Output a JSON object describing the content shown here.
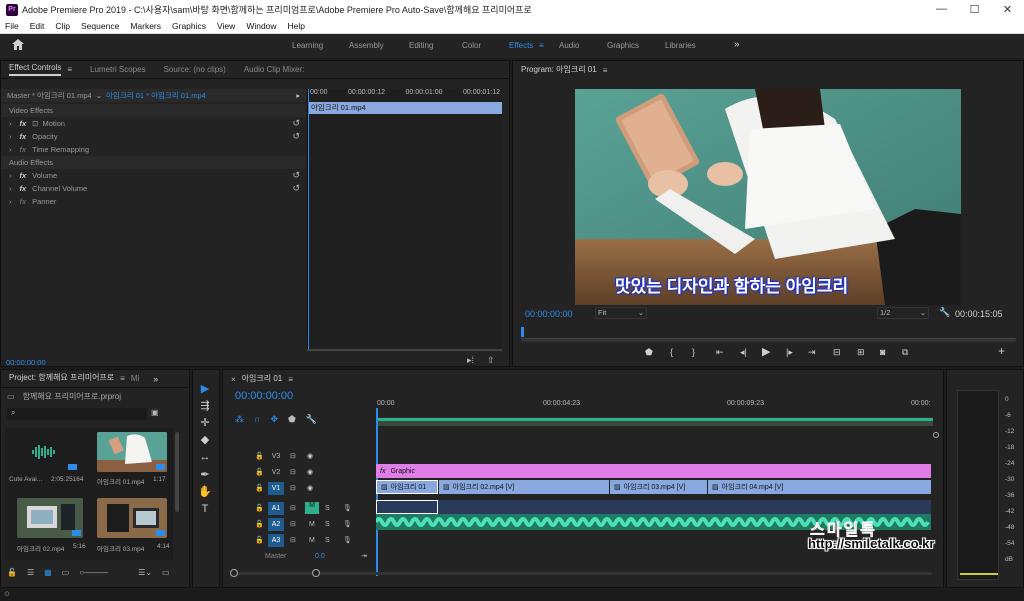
{
  "title_bar": {
    "app_icon": "Pr",
    "title": "Adobe Premiere Pro 2019 - C:\\사용자\\sam\\바탕 화면\\함께하는 프리미엄프로\\Adobe Premiere Pro Auto-Save\\함께해요 프리미어프로",
    "minimize": "—",
    "maximize": "☐",
    "close": "✕"
  },
  "menu": [
    "File",
    "Edit",
    "Clip",
    "Sequence",
    "Markers",
    "Graphics",
    "View",
    "Window",
    "Help"
  ],
  "workspaces": [
    "Learning",
    "Assembly",
    "Editing",
    "Color",
    "Effects",
    "Audio",
    "Graphics",
    "Libraries"
  ],
  "workspace_active": "Effects",
  "workspace_more": "»",
  "source_panel": {
    "tabs": [
      "Effect Controls",
      "Lumetri Scopes",
      "Source: (no clips)",
      "Audio Clip Mixer:"
    ],
    "master_label": "Master * 아임크리 01.mp4",
    "sequence_label": "아임크리 01 * 아임크리 01.mp4",
    "ruler": [
      "00:00",
      "00:00:00:12",
      "00:00:01:00",
      "00:00:01:12"
    ],
    "clip_name": "아임크리 01.mp4",
    "video_effects_label": "Video Effects",
    "audio_effects_label": "Audio Effects",
    "video_effects": [
      "Motion",
      "Opacity",
      "Time Remapping"
    ],
    "audio_effects": [
      "Volume",
      "Channel Volume",
      "Panner"
    ],
    "timecode": "00:00:00:00"
  },
  "program_monitor": {
    "title": "Program: 아임크리 01",
    "subtitle_text": "맛있는 디자인과 함하는 아임크리",
    "timecode_current": "00:00:00:00",
    "fit": "Fit",
    "resolution": "1/2",
    "timecode_end": "00:00:15:05"
  },
  "project_panel": {
    "title": "Project: 함께해요 프리미어프로",
    "tab2": "Mi",
    "file": "함께해요 프리미어프로.prproj",
    "items": [
      {
        "name": "Cute Avai...",
        "duration": "2:05:25164"
      },
      {
        "name": "아임크리 01.mp4",
        "duration": "1:17"
      },
      {
        "name": "아임크리 02.mp4",
        "duration": "5:16"
      },
      {
        "name": "아임크리 03.mp4",
        "duration": "4:14"
      }
    ]
  },
  "timeline": {
    "sequence_tab": "아임크리 01",
    "timecode": "00:00:00:00",
    "ruler": [
      "00:00",
      "00:00:04:23",
      "00:00:09:23",
      "00:00:"
    ],
    "video_tracks": [
      "V3",
      "V2",
      "V1"
    ],
    "audio_tracks": [
      "A1",
      "A2",
      "A3"
    ],
    "master_label": "Master",
    "master_value": "0.0",
    "graphic_clip": "Graphic",
    "v1_clips": [
      "아임크리 01",
      "아임크리 02.mp4 [V]",
      "아임크리 03.mp4 [V]",
      "아임크리 04.mp4 [V]"
    ],
    "track_mute": "M",
    "track_solo": "S"
  },
  "meters": [
    "0",
    "-6",
    "-12",
    "-18",
    "-24",
    "-30",
    "-36",
    "-42",
    "-48",
    "-54",
    "dB"
  ],
  "watermark": {
    "brand": "스마일톡",
    "url": "http://smiletalk.co.kr"
  },
  "colors": {
    "accent": "#2d8ceb",
    "graphic_clip": "#e07ee8",
    "video_clip": "#8aa8e0",
    "audio_clip": "#2fae8e"
  }
}
